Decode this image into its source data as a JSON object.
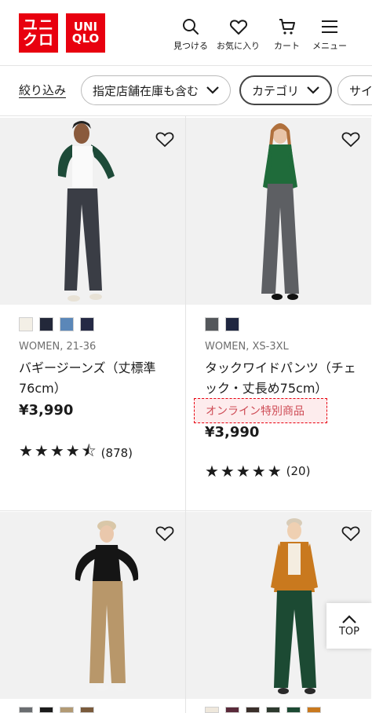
{
  "header": {
    "logo_jp": [
      "ユニ",
      "クロ"
    ],
    "logo_en": [
      "UNI",
      "QLO"
    ],
    "brand_color": "#e8000f",
    "actions": [
      {
        "icon": "search-icon",
        "label": "見つける"
      },
      {
        "icon": "heart-icon",
        "label": "お気に入り"
      },
      {
        "icon": "cart-icon",
        "label": "カート"
      },
      {
        "icon": "menu-icon",
        "label": "メニュー"
      }
    ]
  },
  "filters": {
    "refine_label": "絞り込み",
    "pills": [
      {
        "label": "指定店舗在庫も含む",
        "selected": false
      },
      {
        "label": "カテゴリ",
        "selected": true
      },
      {
        "label": "サイ",
        "selected": false
      }
    ]
  },
  "products": [
    {
      "colors": [
        "#f3efe6",
        "#23283a",
        "#5b87b8",
        "#252a45"
      ],
      "meta": "WOMEN, 21-36",
      "name": "バギージーンズ（丈標準76cm）",
      "badge": "",
      "price": "¥3,990",
      "rating": 4.5,
      "stars": "★★★★",
      "review_count": "(878)"
    },
    {
      "colors": [
        "#54575b",
        "#1f2640"
      ],
      "meta": "WOMEN, XS-3XL",
      "name": "タックワイドパンツ（チェック・丈長め75cm）",
      "badge": "オンライン特別商品",
      "price": "¥3,990",
      "rating": 5,
      "stars": "★★★★★",
      "review_count": "(20)"
    }
  ],
  "top_button": {
    "label": "TOP"
  }
}
